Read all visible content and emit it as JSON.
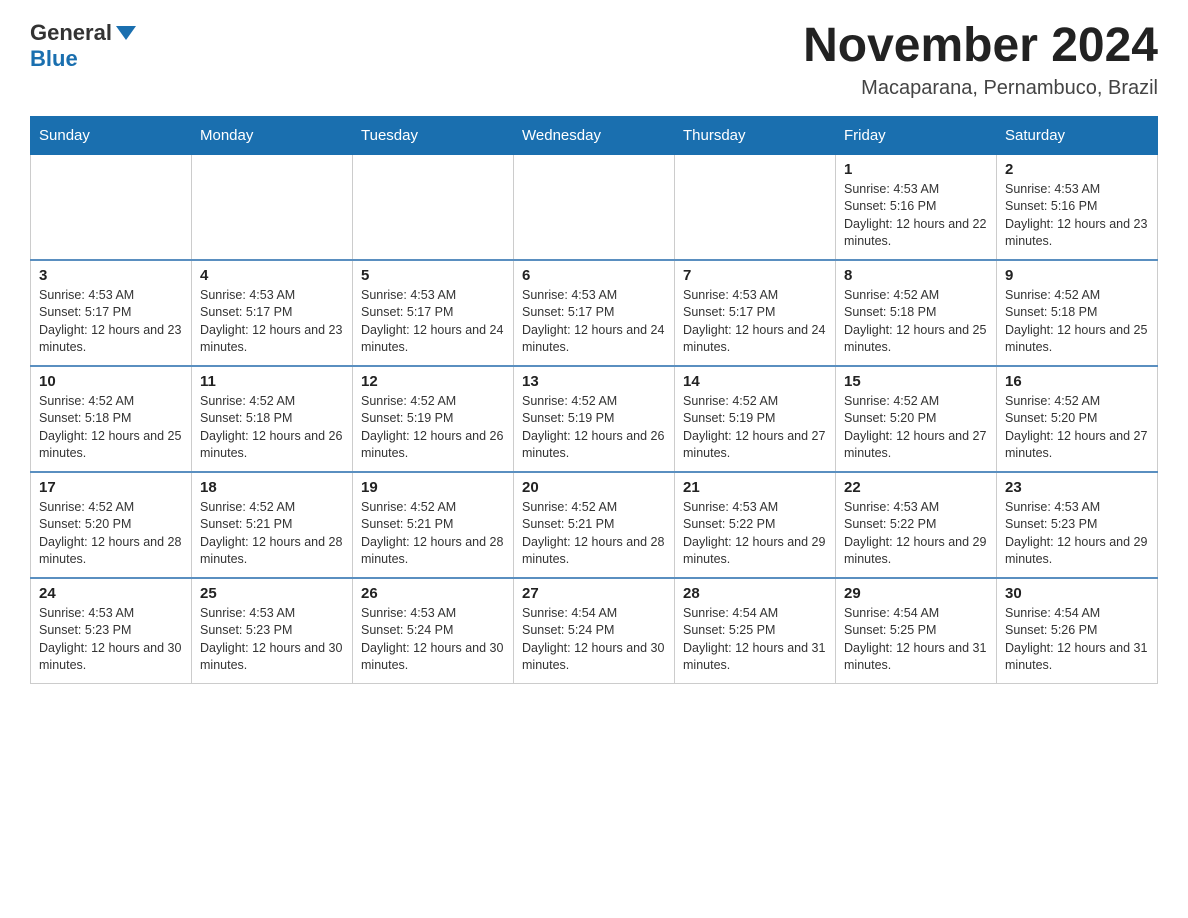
{
  "logo": {
    "general": "General",
    "blue": "Blue"
  },
  "title": {
    "month": "November 2024",
    "location": "Macaparana, Pernambuco, Brazil"
  },
  "weekdays": [
    "Sunday",
    "Monday",
    "Tuesday",
    "Wednesday",
    "Thursday",
    "Friday",
    "Saturday"
  ],
  "weeks": [
    [
      {
        "day": "",
        "sunrise": "",
        "sunset": "",
        "daylight": ""
      },
      {
        "day": "",
        "sunrise": "",
        "sunset": "",
        "daylight": ""
      },
      {
        "day": "",
        "sunrise": "",
        "sunset": "",
        "daylight": ""
      },
      {
        "day": "",
        "sunrise": "",
        "sunset": "",
        "daylight": ""
      },
      {
        "day": "",
        "sunrise": "",
        "sunset": "",
        "daylight": ""
      },
      {
        "day": "1",
        "sunrise": "Sunrise: 4:53 AM",
        "sunset": "Sunset: 5:16 PM",
        "daylight": "Daylight: 12 hours and 22 minutes."
      },
      {
        "day": "2",
        "sunrise": "Sunrise: 4:53 AM",
        "sunset": "Sunset: 5:16 PM",
        "daylight": "Daylight: 12 hours and 23 minutes."
      }
    ],
    [
      {
        "day": "3",
        "sunrise": "Sunrise: 4:53 AM",
        "sunset": "Sunset: 5:17 PM",
        "daylight": "Daylight: 12 hours and 23 minutes."
      },
      {
        "day": "4",
        "sunrise": "Sunrise: 4:53 AM",
        "sunset": "Sunset: 5:17 PM",
        "daylight": "Daylight: 12 hours and 23 minutes."
      },
      {
        "day": "5",
        "sunrise": "Sunrise: 4:53 AM",
        "sunset": "Sunset: 5:17 PM",
        "daylight": "Daylight: 12 hours and 24 minutes."
      },
      {
        "day": "6",
        "sunrise": "Sunrise: 4:53 AM",
        "sunset": "Sunset: 5:17 PM",
        "daylight": "Daylight: 12 hours and 24 minutes."
      },
      {
        "day": "7",
        "sunrise": "Sunrise: 4:53 AM",
        "sunset": "Sunset: 5:17 PM",
        "daylight": "Daylight: 12 hours and 24 minutes."
      },
      {
        "day": "8",
        "sunrise": "Sunrise: 4:52 AM",
        "sunset": "Sunset: 5:18 PM",
        "daylight": "Daylight: 12 hours and 25 minutes."
      },
      {
        "day": "9",
        "sunrise": "Sunrise: 4:52 AM",
        "sunset": "Sunset: 5:18 PM",
        "daylight": "Daylight: 12 hours and 25 minutes."
      }
    ],
    [
      {
        "day": "10",
        "sunrise": "Sunrise: 4:52 AM",
        "sunset": "Sunset: 5:18 PM",
        "daylight": "Daylight: 12 hours and 25 minutes."
      },
      {
        "day": "11",
        "sunrise": "Sunrise: 4:52 AM",
        "sunset": "Sunset: 5:18 PM",
        "daylight": "Daylight: 12 hours and 26 minutes."
      },
      {
        "day": "12",
        "sunrise": "Sunrise: 4:52 AM",
        "sunset": "Sunset: 5:19 PM",
        "daylight": "Daylight: 12 hours and 26 minutes."
      },
      {
        "day": "13",
        "sunrise": "Sunrise: 4:52 AM",
        "sunset": "Sunset: 5:19 PM",
        "daylight": "Daylight: 12 hours and 26 minutes."
      },
      {
        "day": "14",
        "sunrise": "Sunrise: 4:52 AM",
        "sunset": "Sunset: 5:19 PM",
        "daylight": "Daylight: 12 hours and 27 minutes."
      },
      {
        "day": "15",
        "sunrise": "Sunrise: 4:52 AM",
        "sunset": "Sunset: 5:20 PM",
        "daylight": "Daylight: 12 hours and 27 minutes."
      },
      {
        "day": "16",
        "sunrise": "Sunrise: 4:52 AM",
        "sunset": "Sunset: 5:20 PM",
        "daylight": "Daylight: 12 hours and 27 minutes."
      }
    ],
    [
      {
        "day": "17",
        "sunrise": "Sunrise: 4:52 AM",
        "sunset": "Sunset: 5:20 PM",
        "daylight": "Daylight: 12 hours and 28 minutes."
      },
      {
        "day": "18",
        "sunrise": "Sunrise: 4:52 AM",
        "sunset": "Sunset: 5:21 PM",
        "daylight": "Daylight: 12 hours and 28 minutes."
      },
      {
        "day": "19",
        "sunrise": "Sunrise: 4:52 AM",
        "sunset": "Sunset: 5:21 PM",
        "daylight": "Daylight: 12 hours and 28 minutes."
      },
      {
        "day": "20",
        "sunrise": "Sunrise: 4:52 AM",
        "sunset": "Sunset: 5:21 PM",
        "daylight": "Daylight: 12 hours and 28 minutes."
      },
      {
        "day": "21",
        "sunrise": "Sunrise: 4:53 AM",
        "sunset": "Sunset: 5:22 PM",
        "daylight": "Daylight: 12 hours and 29 minutes."
      },
      {
        "day": "22",
        "sunrise": "Sunrise: 4:53 AM",
        "sunset": "Sunset: 5:22 PM",
        "daylight": "Daylight: 12 hours and 29 minutes."
      },
      {
        "day": "23",
        "sunrise": "Sunrise: 4:53 AM",
        "sunset": "Sunset: 5:23 PM",
        "daylight": "Daylight: 12 hours and 29 minutes."
      }
    ],
    [
      {
        "day": "24",
        "sunrise": "Sunrise: 4:53 AM",
        "sunset": "Sunset: 5:23 PM",
        "daylight": "Daylight: 12 hours and 30 minutes."
      },
      {
        "day": "25",
        "sunrise": "Sunrise: 4:53 AM",
        "sunset": "Sunset: 5:23 PM",
        "daylight": "Daylight: 12 hours and 30 minutes."
      },
      {
        "day": "26",
        "sunrise": "Sunrise: 4:53 AM",
        "sunset": "Sunset: 5:24 PM",
        "daylight": "Daylight: 12 hours and 30 minutes."
      },
      {
        "day": "27",
        "sunrise": "Sunrise: 4:54 AM",
        "sunset": "Sunset: 5:24 PM",
        "daylight": "Daylight: 12 hours and 30 minutes."
      },
      {
        "day": "28",
        "sunrise": "Sunrise: 4:54 AM",
        "sunset": "Sunset: 5:25 PM",
        "daylight": "Daylight: 12 hours and 31 minutes."
      },
      {
        "day": "29",
        "sunrise": "Sunrise: 4:54 AM",
        "sunset": "Sunset: 5:25 PM",
        "daylight": "Daylight: 12 hours and 31 minutes."
      },
      {
        "day": "30",
        "sunrise": "Sunrise: 4:54 AM",
        "sunset": "Sunset: 5:26 PM",
        "daylight": "Daylight: 12 hours and 31 minutes."
      }
    ]
  ]
}
